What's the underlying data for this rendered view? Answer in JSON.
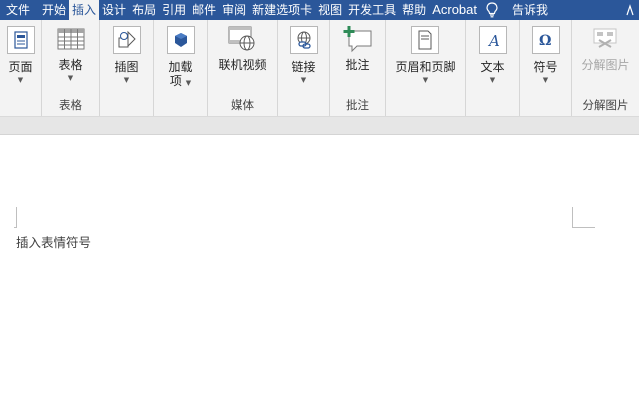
{
  "tabs": [
    {
      "label": "文件"
    },
    {
      "label": "开始"
    },
    {
      "label": "插入"
    },
    {
      "label": "设计"
    },
    {
      "label": "布局"
    },
    {
      "label": "引用"
    },
    {
      "label": "邮件"
    },
    {
      "label": "审阅"
    },
    {
      "label": "新建选项卡"
    },
    {
      "label": "视图"
    },
    {
      "label": "开发工具"
    },
    {
      "label": "帮助"
    },
    {
      "label": "Acrobat"
    }
  ],
  "active_tab": "插入",
  "tell_me": "告诉我",
  "ribbon": {
    "pages": {
      "button": "页面",
      "icon": "page-icon"
    },
    "tables": {
      "button": "表格",
      "group": "表格",
      "icon": "table-icon"
    },
    "illustrations": {
      "button": "插图",
      "icon": "shapes-icon"
    },
    "addins": {
      "button_line1": "加载",
      "button_line2": "项",
      "icon": "store-icon"
    },
    "media": {
      "button": "联机视频",
      "group": "媒体",
      "icon": "video-icon"
    },
    "links": {
      "button": "链接",
      "icon": "link-icon"
    },
    "comments": {
      "button": "批注",
      "group": "批注",
      "icon": "comment-icon"
    },
    "header_footer": {
      "button": "页眉和页脚",
      "icon": "header-footer-icon"
    },
    "text": {
      "button": "文本",
      "icon": "text-icon"
    },
    "symbols": {
      "button": "符号",
      "icon": "omega-icon"
    },
    "split_image": {
      "button": "分解图片",
      "group": "分解图片",
      "icon": "split-image-icon"
    }
  },
  "colors": {
    "tab_bar": "#2b579a",
    "ribbon": "#f3f3f3",
    "accent": "#2b579a",
    "disabled": "#a6a6a6"
  },
  "document": {
    "text": "插入表情符号"
  }
}
